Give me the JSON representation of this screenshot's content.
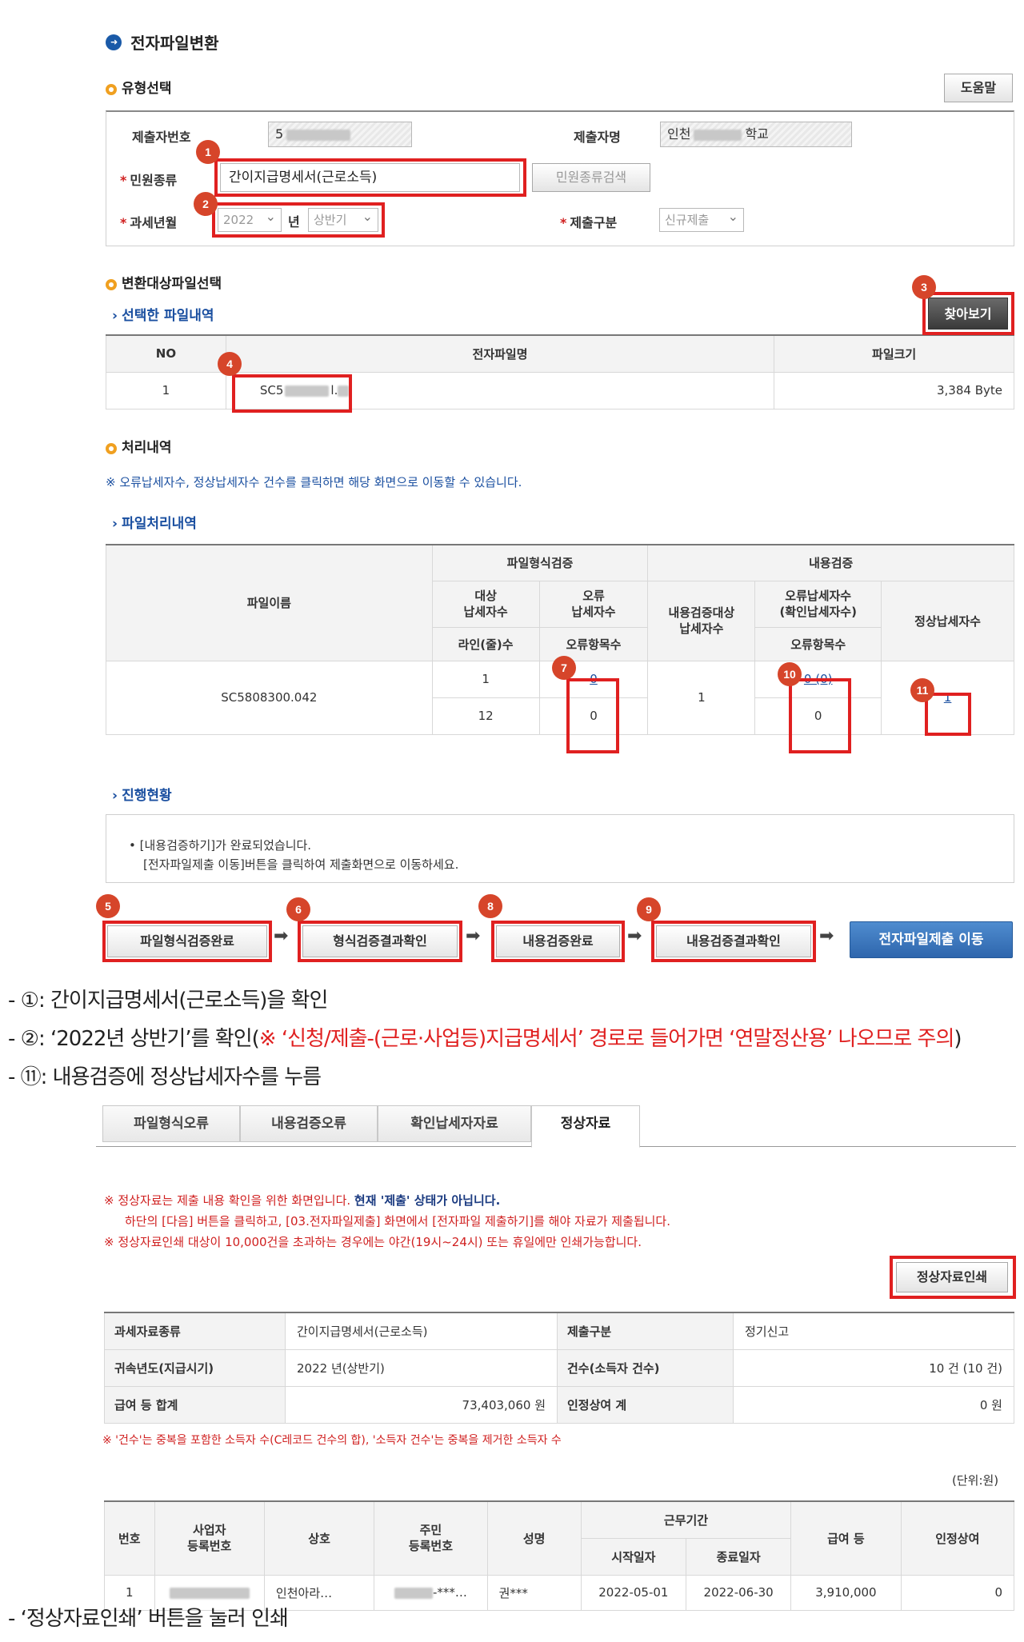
{
  "page": {
    "title": "전자파일변환"
  },
  "type_select": {
    "title": "유형선택",
    "help_label": "도움말",
    "submitter_no_label": "제출자번호",
    "submitter_no_value": "5",
    "submitter_name_label": "제출자명",
    "submitter_name_prefix": "인천",
    "submitter_name_suffix": "학교",
    "civil_type_label": "민원종류",
    "civil_type_value": "간이지급명세서(근로소득)",
    "civil_type_search_label": "민원종류검색",
    "tax_year_label": "과세년월",
    "tax_year_value": "2022",
    "year_unit": "년",
    "half_value": "상반기",
    "submit_type_label": "제출구분",
    "submit_type_value": "신규제출"
  },
  "file_select": {
    "title": "변환대상파일선택",
    "subtitle": "선택한 파일내역",
    "browse_label": "찾아보기",
    "columns": [
      "NO",
      "전자파일명",
      "파일크기"
    ],
    "row_no": "1",
    "row_name_prefix": "SC5",
    "row_name_suffix": "l.",
    "row_size": "3,384 Byte"
  },
  "process": {
    "title": "처리내역",
    "notice": "※ 오류납세자수, 정상납세자수 건수를 클릭하면 해당 화면으로 이동할 수 있습니다.",
    "subtitle": "파일처리내역",
    "col_filename": "파일이름",
    "col_format_check": "파일형식검증",
    "col_content_check": "내용검증",
    "col_target": "대상\n납세자수",
    "col_error": "오류\n납세자수",
    "col_content_target": "내용검증대상\n납세자수",
    "col_error_confirm": "오류납세자수\n(확인납세자수)",
    "col_normal": "정상납세자수",
    "col_lines": "라인(줄)수",
    "col_error_items": "오류항목수",
    "col_error_items2": "오류항목수",
    "filename": "SC5808300.042",
    "target_count": "1",
    "error_count": "0",
    "lines": "12",
    "error_items": "0",
    "content_target": "1",
    "error_confirm": "0 (0)",
    "error_items2": "0",
    "normal_count": "1"
  },
  "progress": {
    "title": "진행현황",
    "line1": "• [내용검증하기]가 완료되었습니다.",
    "line2": "[전자파일제출 이동]버튼을 클릭하여 제출화면으로 이동하세요."
  },
  "flow": {
    "btn1": "파일형식검증완료",
    "btn2": "형식검증결과확인",
    "btn3": "내용검증완료",
    "btn4": "내용검증결과확인",
    "btn5": "전자파일제출 이동"
  },
  "badges": [
    "1",
    "2",
    "3",
    "4",
    "5",
    "6",
    "7",
    "8",
    "9",
    "10",
    "11"
  ],
  "captions": {
    "c1": "- ①: 간이지급명세서(근로소득)을 확인",
    "c2_prefix": "- ②: ‘2022년 상반기’를 확인(",
    "c2_red": "※ ‘신청/제출-(근로·사업등)지급명세서’ 경로로 들어가면 ‘연말정산용’ 나오므로 주의",
    "c2_suffix": ")",
    "c3": "- ⑪: 내용검증에 정상납세자수를 누름",
    "c4": "- ‘정상자료인쇄’ 버튼을 눌러 인쇄"
  },
  "tabs": [
    "파일형식오류",
    "내용검증오류",
    "확인납세자자료",
    "정상자료"
  ],
  "normal_data": {
    "notice1_a": "※ 정상자료는 제출 내용 확인을 위한 화면입니다. ",
    "notice1_b": "현재 '제출' 상태가 아닙니다.",
    "notice2": "하단의 [다음] 버튼을 클릭하고, [03.전자파일제출] 화면에서 [전자파일 제출하기]를 해야 자료가 제출됩니다.",
    "notice3": "※ 정상자료인쇄 대상이 10,000건을 초과하는 경우에는 야간(19시~24시) 또는 휴일에만 인쇄가능합니다.",
    "print_label": "정상자료인쇄",
    "summary": [
      [
        "과세자료종류",
        "간이지급명세서(근로소득)",
        "제출구분",
        "정기신고"
      ],
      [
        "귀속년도(지급시기)",
        "2022 년(상반기)",
        "건수(소득자 건수)",
        "10 건 (10 건)"
      ],
      [
        "급여 등 합계",
        "73,403,060 원",
        "인정상여 계",
        "0 원"
      ]
    ],
    "note": "※ '건수'는 중복을 포함한 소득자 수(C레코드 건수의 합), '소득자 건수'는 중복을 제거한 소득자 수",
    "unit": "(단위:원)",
    "head_no": "번호",
    "head_biz": "사업자\n등록번호",
    "head_name_co": "상호",
    "head_rrn": "주민\n등록번호",
    "head_person": "성명",
    "head_period": "근무기간",
    "head_start": "시작일자",
    "head_end": "종료일자",
    "head_pay": "급여 등",
    "head_bonus": "인정상여",
    "row_no": "1",
    "row_co": "인천아라…",
    "row_rrn_suffix": "-***…",
    "row_person": "권***",
    "row_start": "2022-05-01",
    "row_end": "2022-06-30",
    "row_pay": "3,910,000",
    "row_bonus": "0"
  }
}
